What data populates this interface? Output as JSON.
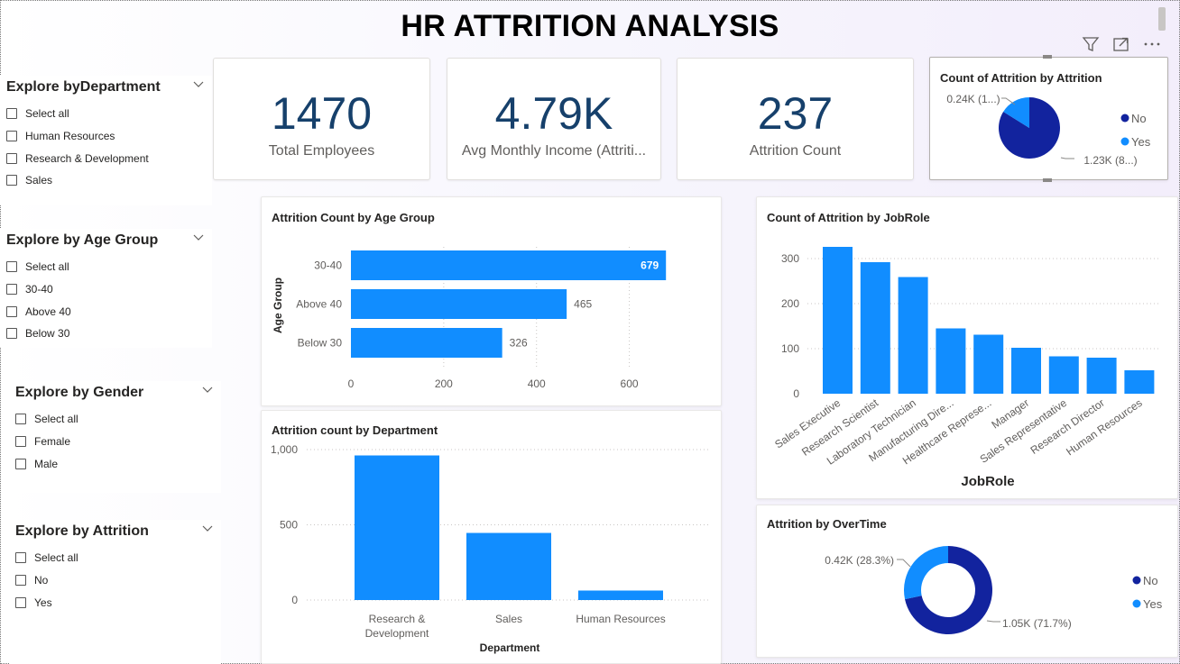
{
  "title": "HR ATTRITION ANALYSIS",
  "slicers": [
    {
      "title": "Explore byDepartment",
      "items": [
        "Select all",
        "Human Resources",
        "Research & Development",
        "Sales"
      ]
    },
    {
      "title": "Explore by Age Group",
      "items": [
        "Select all",
        "30-40",
        "Above 40",
        "Below 30"
      ]
    },
    {
      "title": "Explore by Gender",
      "items": [
        "Select all",
        "Female",
        "Male"
      ]
    },
    {
      "title": "Explore by Attrition",
      "items": [
        "Select all",
        "No",
        "Yes"
      ]
    }
  ],
  "cards": [
    {
      "value": "1470",
      "label": "Total Employees"
    },
    {
      "value": "4.79K",
      "label": "Avg Monthly Income (Attriti..."
    },
    {
      "value": "237",
      "label": "Attrition Count"
    }
  ],
  "icons": [
    "filter-icon",
    "focus-mode-icon",
    "more-options-icon",
    "chevron-down-icon",
    "checkbox-icon"
  ],
  "colors": {
    "primary": "#118dff",
    "dark": "#12239e",
    "card_value": "#16406b"
  },
  "chart_data": [
    {
      "id": "pie_attrition",
      "type": "pie",
      "title": "Count of Attrition by Attrition",
      "slices": [
        {
          "name": "No",
          "value": 1233,
          "label": "1.23K (8...)"
        },
        {
          "name": "Yes",
          "value": 237,
          "label": "0.24K (1...)"
        }
      ],
      "legend": [
        "No",
        "Yes"
      ],
      "legend_position": "right",
      "colors": [
        "#12239e",
        "#118dff"
      ]
    },
    {
      "id": "bar_age",
      "type": "bar",
      "orientation": "horizontal",
      "title": "Attrition Count by Age Group",
      "categories": [
        "30-40",
        "Above 40",
        "Below 30"
      ],
      "values": [
        679,
        465,
        326
      ],
      "ylabel": "Age Group",
      "xlim": [
        0,
        700
      ],
      "xticks": [
        0,
        200,
        400,
        600
      ],
      "grid": true
    },
    {
      "id": "col_jobrole",
      "type": "bar",
      "title": "Count of Attrition by JobRole",
      "categories": [
        "Sales Executive",
        "Research Scientist",
        "Laboratory Technician",
        "Manufacturing Dire...",
        "Healthcare Represe...",
        "Manager",
        "Sales Representative",
        "Research Director",
        "Human Resources"
      ],
      "values": [
        326,
        292,
        259,
        145,
        131,
        102,
        83,
        80,
        52
      ],
      "xlabel": "JobRole",
      "ylim": [
        0,
        350
      ],
      "yticks": [
        0,
        100,
        200,
        300
      ],
      "grid": true
    },
    {
      "id": "col_department",
      "type": "bar",
      "title": "Attrition count by Department",
      "categories": [
        "Research & Development",
        "Sales",
        "Human Resources"
      ],
      "values": [
        961,
        446,
        63
      ],
      "xlabel": "Department",
      "ylim": [
        0,
        1000
      ],
      "yticks": [
        0,
        500,
        1000
      ],
      "ytick_labels": [
        "0",
        "500",
        "1,000"
      ],
      "grid": true
    },
    {
      "id": "donut_overtime",
      "type": "pie",
      "subtype": "donut",
      "title": "Attrition by OverTime",
      "slices": [
        {
          "name": "No",
          "value": 1054,
          "label": "1.05K (71.7%)"
        },
        {
          "name": "Yes",
          "value": 416,
          "label": "0.42K (28.3%)"
        }
      ],
      "legend": [
        "No",
        "Yes"
      ],
      "legend_position": "right",
      "colors": [
        "#12239e",
        "#118dff"
      ]
    }
  ]
}
